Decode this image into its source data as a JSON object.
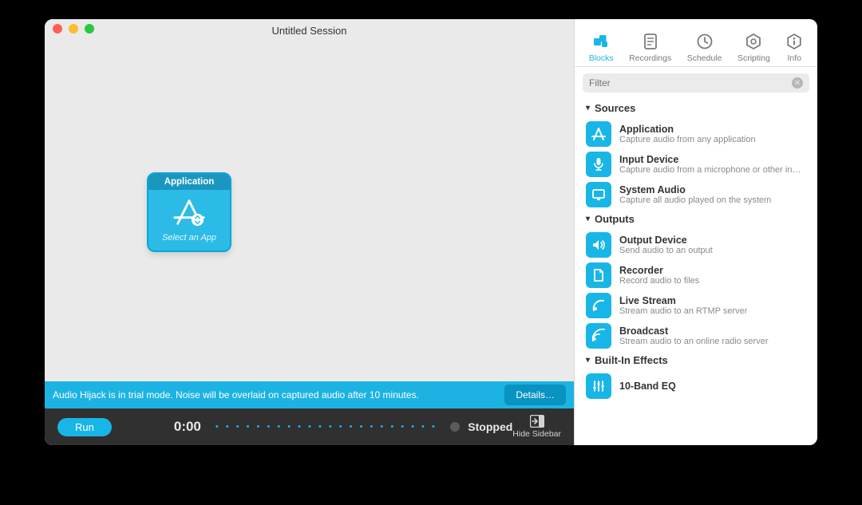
{
  "window": {
    "title": "Untitled Session"
  },
  "block": {
    "header": "Application",
    "subtitle": "Select an App"
  },
  "trial": {
    "message": "Audio Hijack is in trial mode. Noise will be overlaid on captured audio after 10 minutes.",
    "details": "Details…"
  },
  "controls": {
    "run": "Run",
    "timer": "0:00",
    "status": "Stopped",
    "hide_sidebar": "Hide Sidebar"
  },
  "sidebar": {
    "tabs": {
      "blocks": "Blocks",
      "recordings": "Recordings",
      "schedule": "Schedule",
      "scripting": "Scripting",
      "info": "Info"
    },
    "filter_placeholder": "Filter",
    "sections": {
      "sources": "Sources",
      "outputs": "Outputs",
      "builtin": "Built-In Effects"
    },
    "items": {
      "application": {
        "title": "Application",
        "desc": "Capture audio from any application"
      },
      "input_device": {
        "title": "Input Device",
        "desc": "Capture audio from a microphone or other input"
      },
      "system_audio": {
        "title": "System Audio",
        "desc": "Capture all audio played on the system"
      },
      "output_device": {
        "title": "Output Device",
        "desc": "Send audio to an output"
      },
      "recorder": {
        "title": "Recorder",
        "desc": "Record audio to files"
      },
      "live_stream": {
        "title": "Live Stream",
        "desc": "Stream audio to an RTMP server"
      },
      "broadcast": {
        "title": "Broadcast",
        "desc": "Stream audio to an online radio server"
      },
      "ten_band_eq": {
        "title": "10-Band EQ",
        "desc": ""
      }
    }
  }
}
